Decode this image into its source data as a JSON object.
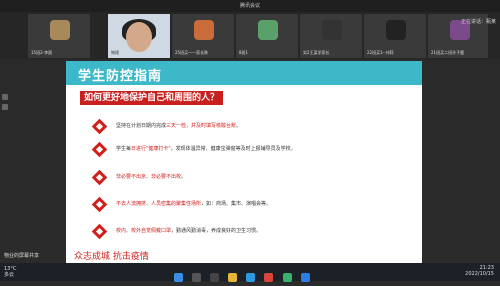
{
  "window": {
    "title": "腾讯会议"
  },
  "participants": [
    {
      "label": "15班2-李宸"
    },
    {
      "label": "物理"
    },
    {
      "label": "25班买一一家长陈"
    },
    {
      "label": "8班1"
    },
    {
      "label": "实2王某学家长"
    },
    {
      "label": "22班买1--刘莉"
    },
    {
      "label": "21班买二班孙子鹿"
    }
  ],
  "speaker": "正在讲话：甄某",
  "slide": {
    "title": "学生防控指南",
    "question": "如何更好地保护自己和周围的人？",
    "items": [
      {
        "pre": "坚持在计划日期内完成",
        "red": "三天一检，并及时填写核酸台账",
        "post": "。"
      },
      {
        "pre": "学生每",
        "red": "日进行\"健康打卡\"",
        "post": "，发现体温异常、健康宝弹窗等及时上报辅导员及学校。"
      },
      {
        "pre": "",
        "red": "非必要不出京、非必要不出校",
        "post": "。"
      },
      {
        "pre": "",
        "red": "不去人流拥挤、人员密集的聚集性场所",
        "post": "，如：商场、集市、演唱会等。"
      },
      {
        "pre": "",
        "red": "校内、校外自觉佩戴口罩",
        "post": "，勤通风勤消毒，养成良好的卫生习惯。"
      }
    ],
    "footer": "众志成城  抗击疫情"
  },
  "meeting_label": "物业的屏幕共享",
  "taskbar": {
    "weather_temp": "13°C",
    "weather_desc": "多云",
    "time": "21:23",
    "date": "2022/10/15"
  }
}
